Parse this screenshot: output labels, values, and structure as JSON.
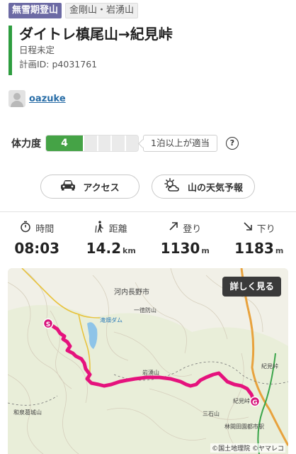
{
  "tags": {
    "season": "無雪期登山",
    "area": "金剛山・岩湧山"
  },
  "plan": {
    "title": "ダイトレ槙尾山→紀見峠",
    "schedule": "日程未定",
    "plan_id": "計画ID: p4031761"
  },
  "user": {
    "name": "oazuke"
  },
  "stamina": {
    "label": "体力度",
    "level": "4",
    "level_fraction": 0.4,
    "note": "1泊以上が適当",
    "help": "?"
  },
  "actions": {
    "access": "アクセス",
    "weather": "山の天気予報"
  },
  "stats": {
    "time": {
      "label": "時間",
      "value": "08:03"
    },
    "distance": {
      "label": "距離",
      "value": "14.2",
      "unit": "km"
    },
    "ascent": {
      "label": "登り",
      "value": "1130",
      "unit": "m"
    },
    "descent": {
      "label": "下り",
      "value": "1183",
      "unit": "m"
    }
  },
  "map": {
    "button": "詳しく見る",
    "labels": {
      "city": "河内長野市",
      "peak1": "一徳防山",
      "dam": "滝畑ダム",
      "iwawaki": "岩湧山",
      "kimi": "紀見峠",
      "mitsuishi": "三石山",
      "rinkan": "林間田園都市駅",
      "izumi": "和泉葛城山",
      "kimi_e": "紀見峠",
      "start": "S",
      "goal": "G"
    },
    "credit": "©国土地理院 ©ヤマレコ",
    "route_color": "#e5127d"
  }
}
